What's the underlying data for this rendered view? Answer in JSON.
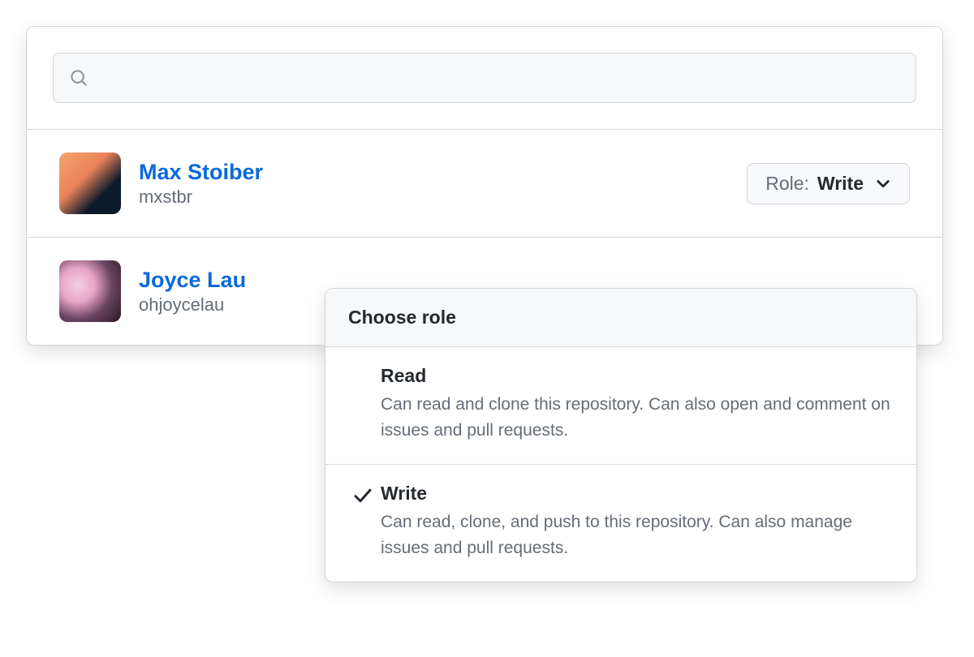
{
  "search": {
    "placeholder": ""
  },
  "users": [
    {
      "name": "Max Stoiber",
      "handle": "mxstbr",
      "role_prefix": "Role:",
      "role_value": "Write"
    },
    {
      "name": "Joyce Lau",
      "handle": "ohjoycelau"
    }
  ],
  "dropdown": {
    "header": "Choose role",
    "options": [
      {
        "title": "Read",
        "description": "Can read and clone this repository. Can also open and comment on issues and pull requests.",
        "selected": false
      },
      {
        "title": "Write",
        "description": "Can read, clone, and push to this repository. Can also manage issues and pull requests.",
        "selected": true
      }
    ]
  },
  "colors": {
    "link": "#0969da",
    "muted": "#656d76",
    "border": "#d0d7de",
    "bg_subtle": "#f6f8fa"
  }
}
